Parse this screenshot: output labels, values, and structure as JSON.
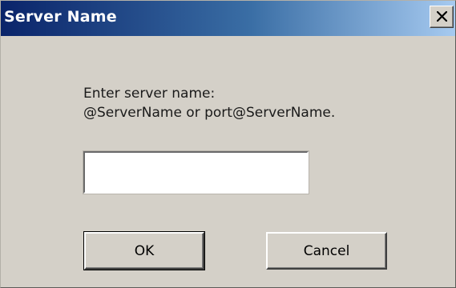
{
  "window": {
    "title": "Server Name",
    "close_icon": "close-icon"
  },
  "dialog": {
    "prompt_line1": "Enter server name:",
    "prompt_line2": "@ServerName or port@ServerName.",
    "server_input_value": "",
    "ok_label": "OK",
    "cancel_label": "Cancel"
  },
  "colors": {
    "titlebar_start": "#0a246a",
    "titlebar_end": "#a6caf0",
    "dialog_background": "#d4d0c8"
  }
}
